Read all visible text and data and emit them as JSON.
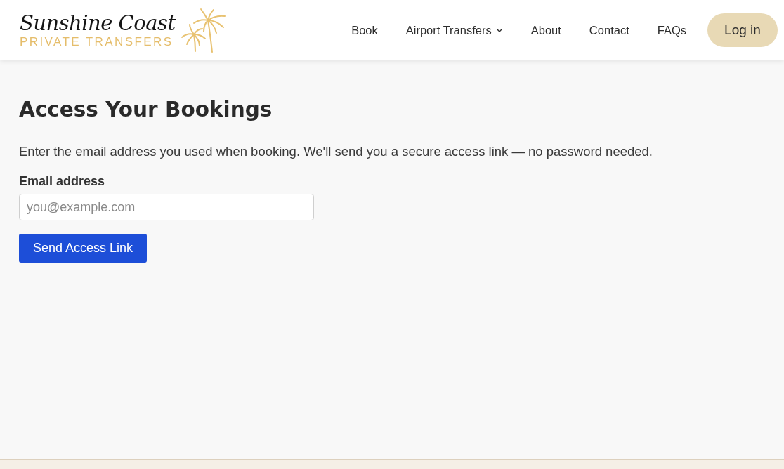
{
  "header": {
    "logo": {
      "title": "Sunshine Coast",
      "subtitle": "PRIVATE TRANSFERS"
    },
    "nav": [
      {
        "label": "Book",
        "kind": "link"
      },
      {
        "label": "Airport Transfers",
        "kind": "dropdown"
      },
      {
        "label": "About",
        "kind": "link"
      },
      {
        "label": "Contact",
        "kind": "link"
      },
      {
        "label": "FAQs",
        "kind": "link"
      }
    ],
    "login_button": "Log in"
  },
  "main": {
    "title": "Access Your Bookings",
    "description": "Enter the email address you used when booking. We'll send you a secure access link — no password needed.",
    "email_field": {
      "label": "Email address",
      "placeholder": "you@example.com"
    },
    "submit_button": "Send Access Link"
  }
}
